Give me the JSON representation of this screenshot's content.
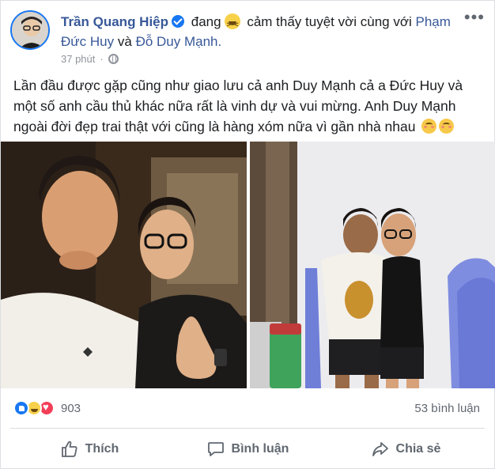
{
  "post": {
    "author": "Trần Quang Hiệp",
    "feeling_prefix": "đang",
    "feeling_text": "cảm thấy tuyệt vời cùng với",
    "tag_1": "Phạm Đức Huy",
    "conjunction": "và",
    "tag_2": "Đỗ Duy Mạnh.",
    "timestamp": "37 phút",
    "more_label": "•••",
    "text_line_1": "Lần đầu được gặp cũng như giao lưu cả anh Duy Mạnh cả a Đức Huy và một số anh cầu thủ khác nữa rất là vinh dự và vui mừng. Anh Duy Mạnh ngoài đời đẹp trai thật với cũng là hàng xóm nữa vì gần nhà nhau"
  },
  "icons": {
    "verified": "verified-badge-icon",
    "feeling": "grinning-squinting-emoji-icon",
    "privacy": "globe-icon",
    "blush": "smiling-blush-emoji-icon"
  },
  "reactions": {
    "count": "903",
    "comments": "53 bình luận"
  },
  "actions": {
    "like": "Thích",
    "comment": "Bình luận",
    "share": "Chia sẻ"
  },
  "colors": {
    "brand": "#1877f2",
    "link": "#385898",
    "secondary_text": "#606770"
  }
}
